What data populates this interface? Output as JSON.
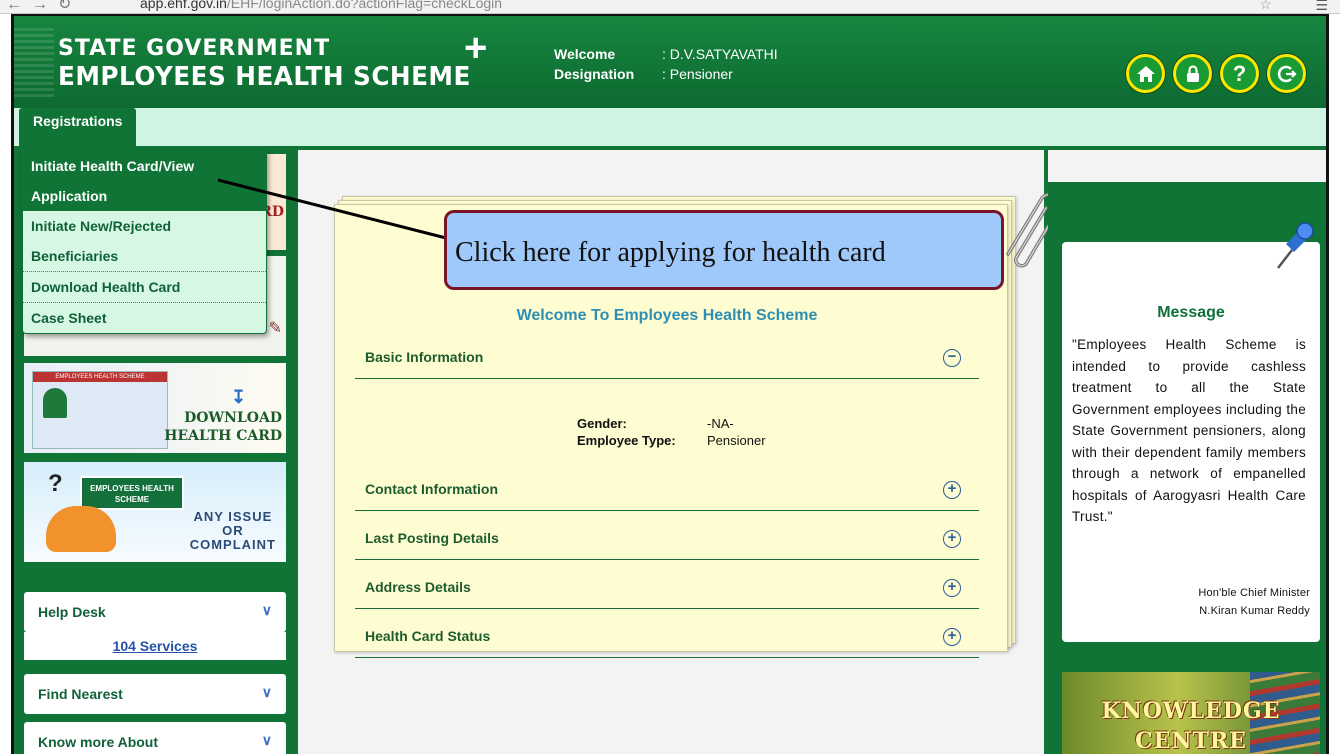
{
  "browser": {
    "url_host": "app.ehf.gov.in",
    "url_path": "/EHF/loginAction.do?actionFlag=checkLogin"
  },
  "header": {
    "logo_line1": "STATE GOVERNMENT",
    "logo_line2": "EMPLOYEES HEALTH SCHEME",
    "logo_plus": "+",
    "welcome_label": "Welcome",
    "welcome_value": ": D.V.SATYAVATHI",
    "designation_label": "Designation",
    "designation_value": ": Pensioner",
    "icons": [
      "home-icon",
      "lock-icon",
      "help-icon",
      "logout-icon"
    ]
  },
  "tabs": {
    "registrations": "Registrations"
  },
  "menu": {
    "items": [
      "Initiate Health Card/View Application",
      "Initiate New/Rejected Beneficiaries",
      "Download Health Card",
      "Case Sheet"
    ]
  },
  "sidebar": {
    "promo_top_partial": "RD",
    "download_card": {
      "line1": "DOWNLOAD",
      "line2": "HEALTH CARD",
      "card_band": "EMPLOYEES HEALTH SCHEME"
    },
    "issue": {
      "badge": "EMPLOYEES HEALTH SCHEME",
      "line1": "ANY ISSUE",
      "line2": "OR",
      "line3": "COMPLAINT"
    },
    "help_desk": "Help Desk",
    "services_link": "104 Services",
    "find_nearest": "Find Nearest",
    "know_more": "Know more About"
  },
  "main": {
    "welcome_title": "Welcome To Employees Health Scheme",
    "sections": [
      {
        "label": "Basic Information",
        "state": "expanded"
      },
      {
        "label": "Contact Information",
        "state": "collapsed"
      },
      {
        "label": "Last Posting Details",
        "state": "collapsed"
      },
      {
        "label": "Address Details",
        "state": "collapsed"
      },
      {
        "label": "Health Card Status",
        "state": "collapsed"
      }
    ],
    "basic_info": {
      "gender_label": "Gender:",
      "gender_value": "-NA-",
      "emp_type_label": "Employee Type:",
      "emp_type_value": "Pensioner"
    }
  },
  "callout": {
    "text": "Click here for applying for health card"
  },
  "message": {
    "title": "Message",
    "body": "\"Employees Health Scheme is intended to provide cashless treatment to all the State Government employees including the State Government pensioners, along with their dependent family members through a network of empanelled hospitals of Aarogyasri Health Care Trust.\"",
    "sign_title": "Hon'ble Chief Minister",
    "sign_name": "N.Kiran Kumar Reddy"
  },
  "knowledge": {
    "line1": "KNOWLEDGE",
    "line2": "CENTRE"
  },
  "colors": {
    "brand_green": "#0f7436",
    "menu_bg": "#d6f8e2",
    "callout_bg": "#9fc8fb",
    "callout_border": "#7a1428",
    "paper": "#fefcd1"
  }
}
